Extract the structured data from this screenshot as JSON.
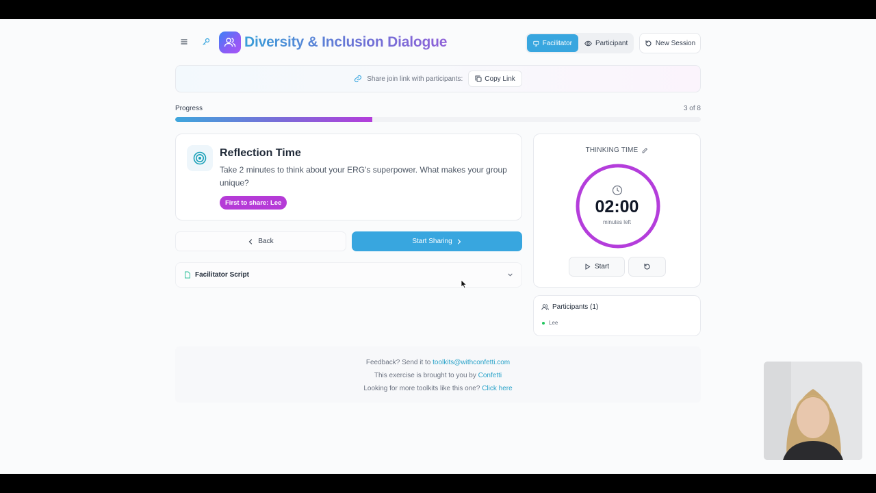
{
  "header": {
    "title": "Diversity & Inclusion Dialogue",
    "modes": {
      "facilitator": "Facilitator",
      "participant": "Participant"
    },
    "new_session": "New Session"
  },
  "share": {
    "text": "Share join link with participants:",
    "copy_label": "Copy Link"
  },
  "progress": {
    "label": "Progress",
    "count": "3 of 8",
    "fraction": 0.375
  },
  "prompt": {
    "title": "Reflection Time",
    "text": "Take 2 minutes to think about your ERG's superpower. What makes your group unique?",
    "first_to_share": "First to share: Lee"
  },
  "nav": {
    "back": "Back",
    "start_sharing": "Start Sharing"
  },
  "script": {
    "label": "Facilitator Script"
  },
  "timer": {
    "heading": "THINKING TIME",
    "value": "02:00",
    "sub": "minutes left",
    "start": "Start",
    "ring_color": "#b43ddb"
  },
  "participants": {
    "title": "Participants (1)",
    "list": [
      "Lee"
    ]
  },
  "footer": {
    "feedback_prefix": "Feedback? Send it to",
    "feedback_email": "toolkits@withconfetti.com",
    "brought_prefix": "This exercise is brought to you by",
    "brought_link": "Confetti",
    "more_prefix": "Looking for more toolkits like this one?",
    "more_link": "Click here"
  },
  "colors": {
    "accent": "#38a6df",
    "badge": "#b53bd7",
    "link": "#2aa3c9"
  }
}
